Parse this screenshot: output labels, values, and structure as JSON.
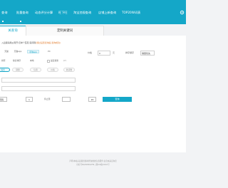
{
  "nav": {
    "items": [
      "查询",
      "批量查询",
      "动态评分计算",
      "旺下旺",
      "淘宝违规查询",
      "店铺上新查询",
      "TOP20W词表"
    ],
    "settings_icon": "gear-icon"
  },
  "page_tabs": {
    "active": "关查询",
    "inactive": "定制关键词"
  },
  "subtabs": [
    "常规词查询",
    "常规查询"
  ],
  "note": {
    "text": "入后缀请用|||隔开,仅单个匹配,需间隔",
    "highlight": "(通过设置查询后,查询成功)"
  },
  "platforms": [
    "天猫",
    "天猫app",
    "手淘app",
    "PC"
  ],
  "platform_selected": 2,
  "filters": {
    "options": [
      "排序",
      "综合排序",
      "本地"
    ],
    "checkbox_label": "最近搜索",
    "checkbox_suffix": "(?)"
  },
  "right_fields": {
    "label1": "价格",
    "value1": "0",
    "unit1": "元",
    "label2": "排序顺序",
    "value2": "销量优先"
  },
  "pills": [
    "综合",
    "销量",
    "信用",
    "价格",
    "收货数"
  ],
  "pill_selected": 0,
  "inputs": {
    "start_label": "页码",
    "start_value": "1",
    "end_label": "停止页:",
    "end_value": "20"
  },
  "query_button": "查询",
  "footer": {
    "line1": "声明:本站只是提供各种查询类的信息服务,信息未来自淘宝",
    "line2": "旺旺号BGHXEDGF8I | 浙ICP备XXXX号"
  },
  "colors": {
    "accent": "#14a7c8",
    "background": "#f2f3f5"
  }
}
